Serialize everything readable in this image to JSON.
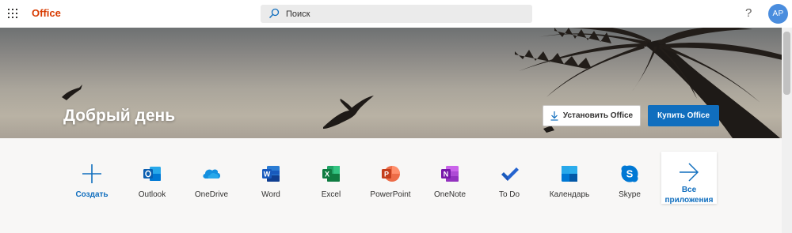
{
  "topbar": {
    "brand": "Office",
    "search_placeholder": "Поиск",
    "help": "?",
    "avatar": "AP"
  },
  "hero": {
    "greeting": "Добрый день",
    "install_label": "Установить Office",
    "buy_label": "Купить Office"
  },
  "apps": [
    {
      "label": "Создать",
      "icon": "plus-icon"
    },
    {
      "label": "Outlook",
      "icon": "outlook-icon"
    },
    {
      "label": "OneDrive",
      "icon": "onedrive-icon"
    },
    {
      "label": "Word",
      "icon": "word-icon"
    },
    {
      "label": "Excel",
      "icon": "excel-icon"
    },
    {
      "label": "PowerPoint",
      "icon": "powerpoint-icon"
    },
    {
      "label": "OneNote",
      "icon": "onenote-icon"
    },
    {
      "label": "To Do",
      "icon": "todo-icon"
    },
    {
      "label": "Календарь",
      "icon": "calendar-icon"
    },
    {
      "label": "Skype",
      "icon": "skype-icon"
    }
  ],
  "all_apps": {
    "line1": "Все",
    "line2": "приложения",
    "icon": "arrow-right-icon"
  },
  "colors": {
    "brand": "#d83b01",
    "accent": "#106ebe",
    "avatar": "#4a8dde"
  }
}
